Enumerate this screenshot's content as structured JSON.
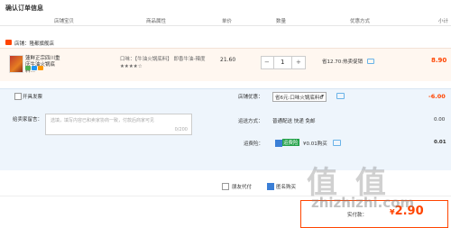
{
  "page_title": "确认订单信息",
  "columns": [
    "店铺宝贝",
    "商品属性",
    "单价",
    "数量",
    "优惠方式",
    "小计"
  ],
  "shop": {
    "label": "店铺：",
    "name": "隆都旗舰店"
  },
  "item": {
    "name": "蓮鲜正宗四川重庆牛油火锅底料…",
    "sku": "口味：【牛油火锅底料】 即香牛油-辣度★★★★☆",
    "price": "21.60",
    "quantity": "1",
    "minus": "−",
    "plus": "+",
    "promo": "省12.70:热卖促销",
    "subtotal": "8.90"
  },
  "invoice_label": "开具发票",
  "seller_message": {
    "label": "给卖家留言：",
    "placeholder": "选填，填写内容已和卖家协商一致，付款后商家可见",
    "counter": "0/200"
  },
  "shop_discount": {
    "label": "店铺优惠：",
    "selected": "省6元:口味火锅底料6",
    "value": "-6.00"
  },
  "shipping": {
    "label": "运送方式：",
    "value": "普通配送 快递 免邮",
    "amount": "0.00"
  },
  "insurance": {
    "label": "运费险：",
    "tag": "运费险",
    "price": "¥0.01购买",
    "amount": "0.01"
  },
  "bottom_options": {
    "agent_pay": "朋友代付",
    "anonymous": "匿名购买"
  },
  "payment": {
    "label": "实付款：",
    "currency": "¥",
    "amount": "2.90"
  },
  "watermark": {
    "text": "值 值",
    "url": "zhizhizhi.com"
  },
  "colors": {
    "accent": "#f40",
    "blue": "#3b7fd6",
    "green": "#24a24a",
    "panel": "#eef5fc"
  }
}
